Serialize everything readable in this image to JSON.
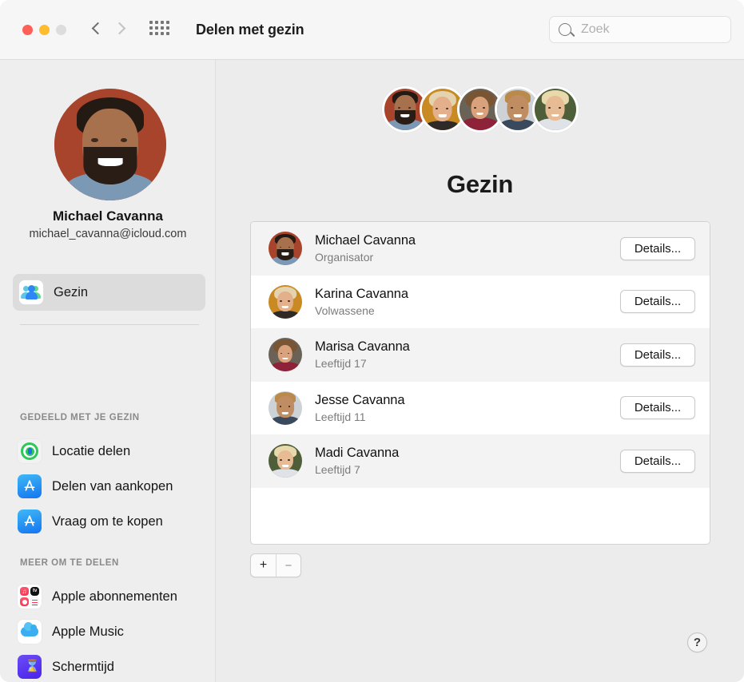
{
  "window": {
    "title": "Delen met gezin",
    "traffic_lights": [
      "close",
      "minimize",
      "zoom"
    ],
    "back_icon": "chevron-left-icon",
    "forward_icon": "chevron-right-icon",
    "grid_icon": "grid-view-icon"
  },
  "search": {
    "placeholder": "Zoek",
    "icon": "search-icon",
    "value": ""
  },
  "sidebar": {
    "profile": {
      "name": "Michael Cavanna",
      "email": "michael_cavanna@icloud.com",
      "avatar": "profile-photo"
    },
    "selected_item": {
      "label": "Gezin",
      "icon": "family-group-icon"
    },
    "groups": [
      {
        "title": "GEDEELD MET JE GEZIN",
        "items": [
          {
            "label": "Locatie delen",
            "icon": "find-my-icon"
          },
          {
            "label": "Delen van aankopen",
            "icon": "app-store-icon"
          },
          {
            "label": "Vraag om te kopen",
            "icon": "app-store-icon"
          }
        ]
      },
      {
        "title": "MEER OM TE DELEN",
        "items": [
          {
            "label": "Apple abonnementen",
            "icon": "apple-subscriptions-icon"
          },
          {
            "label": "Apple Music",
            "icon": "icloud-music-icon"
          },
          {
            "label": "Schermtijd",
            "icon": "screen-time-icon"
          }
        ]
      }
    ]
  },
  "main": {
    "page_title": "Gezin",
    "header_avatars": [
      "michael-avatar",
      "karina-avatar",
      "marisa-avatar",
      "jesse-avatar",
      "madi-avatar"
    ],
    "members": [
      {
        "name": "Michael Cavanna",
        "role": "Organisator",
        "button": "Details...",
        "avatar": "michael-avatar"
      },
      {
        "name": "Karina Cavanna",
        "role": "Volwassene",
        "button": "Details...",
        "avatar": "karina-avatar"
      },
      {
        "name": "Marisa Cavanna",
        "role": "Leeftijd 17",
        "button": "Details...",
        "avatar": "marisa-avatar"
      },
      {
        "name": "Jesse Cavanna",
        "role": "Leeftijd 11",
        "button": "Details...",
        "avatar": "jesse-avatar"
      },
      {
        "name": "Madi Cavanna",
        "role": "Leeftijd 7",
        "button": "Details...",
        "avatar": "madi-avatar"
      }
    ],
    "add_button": "+",
    "remove_button": "−",
    "help_button": "?"
  },
  "colors": {
    "window_background": "#ececec",
    "sidebar_background": "#eeeeee",
    "titlebar_background": "#f6f6f6",
    "list_background": "#ffffff",
    "list_alt_row": "#f3f3f3",
    "close_red": "#ff5f57",
    "minimize_amber": "#febc2e",
    "zoom_gray": "#dddddd",
    "secondary_text": "#7b7b7b"
  }
}
